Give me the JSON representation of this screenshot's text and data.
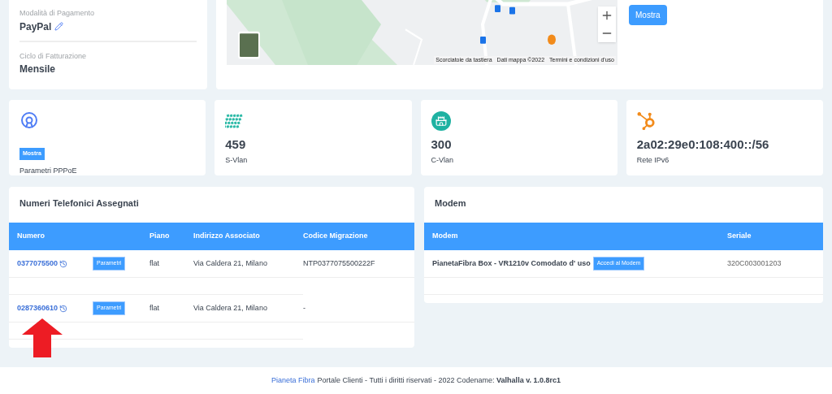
{
  "billing": {
    "fields": [
      {
        "label": "Modalità di Pagamento",
        "value": "PayPal",
        "editable": true
      },
      {
        "label": "Ciclo di Fatturazione",
        "value": "Mensile",
        "editable": false
      }
    ]
  },
  "map": {
    "attribution": [
      "Scorciatoie da tastiera",
      "Dati mappa ©2022",
      "Termini e condizioni d'uso"
    ]
  },
  "migration": {
    "button": "Mostra"
  },
  "stats": [
    {
      "kind": "button",
      "button": "Mostra",
      "label": "Parametri PPPoE"
    },
    {
      "kind": "value",
      "value": "459",
      "label": "S-Vlan"
    },
    {
      "kind": "value",
      "value": "300",
      "label": "C-Vlan"
    },
    {
      "kind": "value",
      "value": "2a02:29e0:108:400::/56",
      "label": "Rete IPv6"
    }
  ],
  "phones": {
    "title": "Numeri Telefonici Assegnati",
    "columns": [
      "Numero",
      "Piano",
      "Indirizzo Associato",
      "Codice Migrazione"
    ],
    "rows": [
      {
        "number": "0377075500",
        "button": "Parametri",
        "plan": "flat",
        "address": "Via Caldera 21, Milano",
        "migration_code": "NTP0377075500222F"
      },
      {
        "number": "0287360610",
        "button": "Parametri",
        "plan": "flat",
        "address": "Via Caldera 21, Milano",
        "migration_code": "-"
      }
    ]
  },
  "modem": {
    "title": "Modem",
    "columns": [
      "Modem",
      "Seriale"
    ],
    "rows": [
      {
        "model": "PianetaFibra Box - VR1210v Comodato d' uso",
        "button": "Accedi al Modem",
        "serial": "320C003001203"
      }
    ]
  },
  "footer": {
    "brand": "Pianeta Fibra",
    "text": "Portale Clienti - Tutti i diritti riservati - 2022 Codename: **Valhalla v. 1.0.8rc1**"
  }
}
